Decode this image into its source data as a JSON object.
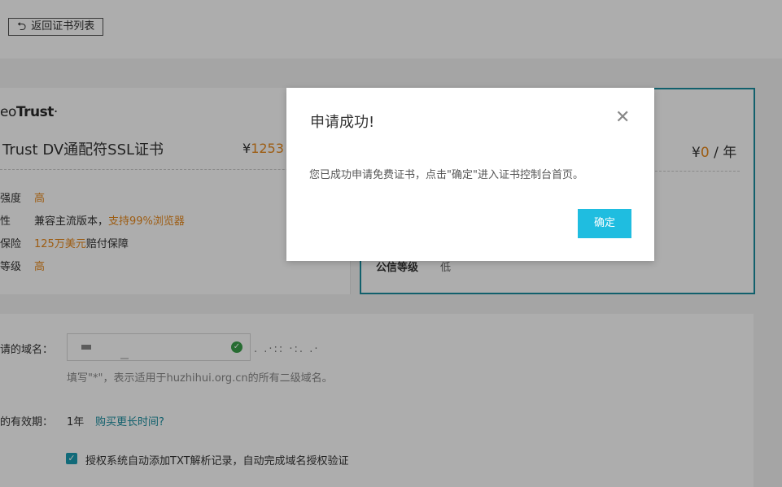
{
  "topbar": {
    "back_label": "返回证书列表"
  },
  "left_card": {
    "brand_prefix": "eo",
    "brand_main": "Trust",
    "brand_suffix": "·",
    "product_name": "Trust DV通配符SSL证书",
    "price_symbol": "¥",
    "price_value": "1253",
    "rows": [
      {
        "label": "强度",
        "value": "高",
        "value_orange": true
      },
      {
        "label": "性",
        "value_pre": "兼容主流版本，",
        "value_orange_text": "支持99%浏览器"
      },
      {
        "label": "保险",
        "value_orange_text": "125万美元",
        "value_post": "赔付保障"
      },
      {
        "label": "等级",
        "value": "高",
        "value_orange": true
      }
    ]
  },
  "right_card": {
    "price_symbol": "¥",
    "price_value": "0",
    "price_unit": "/ 年",
    "trust_label": "公信等级",
    "trust_value": "低"
  },
  "form": {
    "domain_label": "请的域名：",
    "domain_hint": "填写\"*\"，表示适用于huzhihui.org.cn的所有二级域名。",
    "validity_label": "的有效期：",
    "validity_value": "1年",
    "buy_more_link": "购买更长时间?",
    "auth_text": "授权系统自动添加TXT解析记录，自动完成域名授权验证"
  },
  "modal": {
    "title": "申请成功!",
    "body": "您已成功申请免费证书，点击\"确定\"进入证书控制台首页。",
    "ok_label": "确定",
    "close_icon": "close-icon"
  },
  "colors": {
    "accent": "#1fbde0",
    "highlight_border": "#1a8ea0",
    "orange": "#e8891d"
  }
}
